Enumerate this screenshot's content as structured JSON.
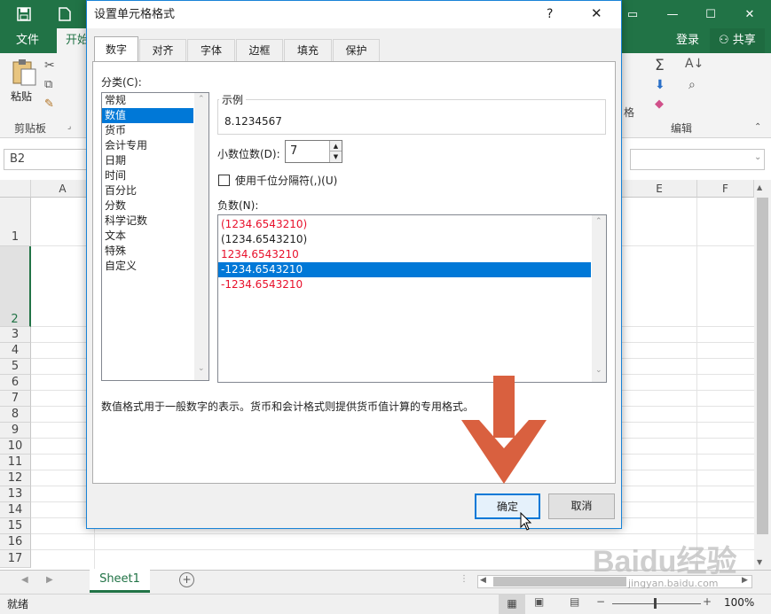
{
  "excel": {
    "ribbon_tabs": [
      "文件",
      "开始"
    ],
    "user_signin": "登录",
    "share_label": "共享",
    "paste_label": "粘贴",
    "clipboard_group": "剪贴板",
    "edit_group": "编辑",
    "ribbon_partial_1": "格",
    "name_box": "B2",
    "column_headers": [
      "A",
      "E",
      "F"
    ],
    "row_headers": [
      "1",
      "2",
      "3",
      "4",
      "5",
      "6",
      "7",
      "8",
      "9",
      "10",
      "11",
      "12",
      "13",
      "14",
      "15",
      "16",
      "17"
    ],
    "sheet_tab": "Sheet1",
    "status_ready": "就绪",
    "zoom_level": "100%"
  },
  "dialog": {
    "title": "设置单元格格式",
    "help_label": "?",
    "tabs": [
      "数字",
      "对齐",
      "字体",
      "边框",
      "填充",
      "保护"
    ],
    "category_label": "分类(C):",
    "categories": [
      "常规",
      "数值",
      "货币",
      "会计专用",
      "日期",
      "时间",
      "百分比",
      "分数",
      "科学记数",
      "文本",
      "特殊",
      "自定义"
    ],
    "selected_category": "数值",
    "sample_label": "示例",
    "sample_value": "8.1234567",
    "decimal_label": "小数位数(D):",
    "decimal_value": "7",
    "thousands_label": "使用千位分隔符(,)(U)",
    "negative_label": "负数(N):",
    "negative_options": [
      "(1234.6543210)",
      "(1234.6543210)",
      "1234.6543210",
      "-1234.6543210",
      "-1234.6543210"
    ],
    "description": "数值格式用于一般数字的表示。货币和会计格式则提供货币值计算的专用格式。",
    "ok_label": "确定",
    "cancel_label": "取消"
  },
  "watermark": {
    "text": "Baidu经验",
    "url": "jingyan.baidu.com"
  },
  "colors": {
    "excel_green": "#217346",
    "selection_blue": "#0078d7",
    "negative_red": "#e8102b",
    "arrow_orange": "#d9603f"
  }
}
